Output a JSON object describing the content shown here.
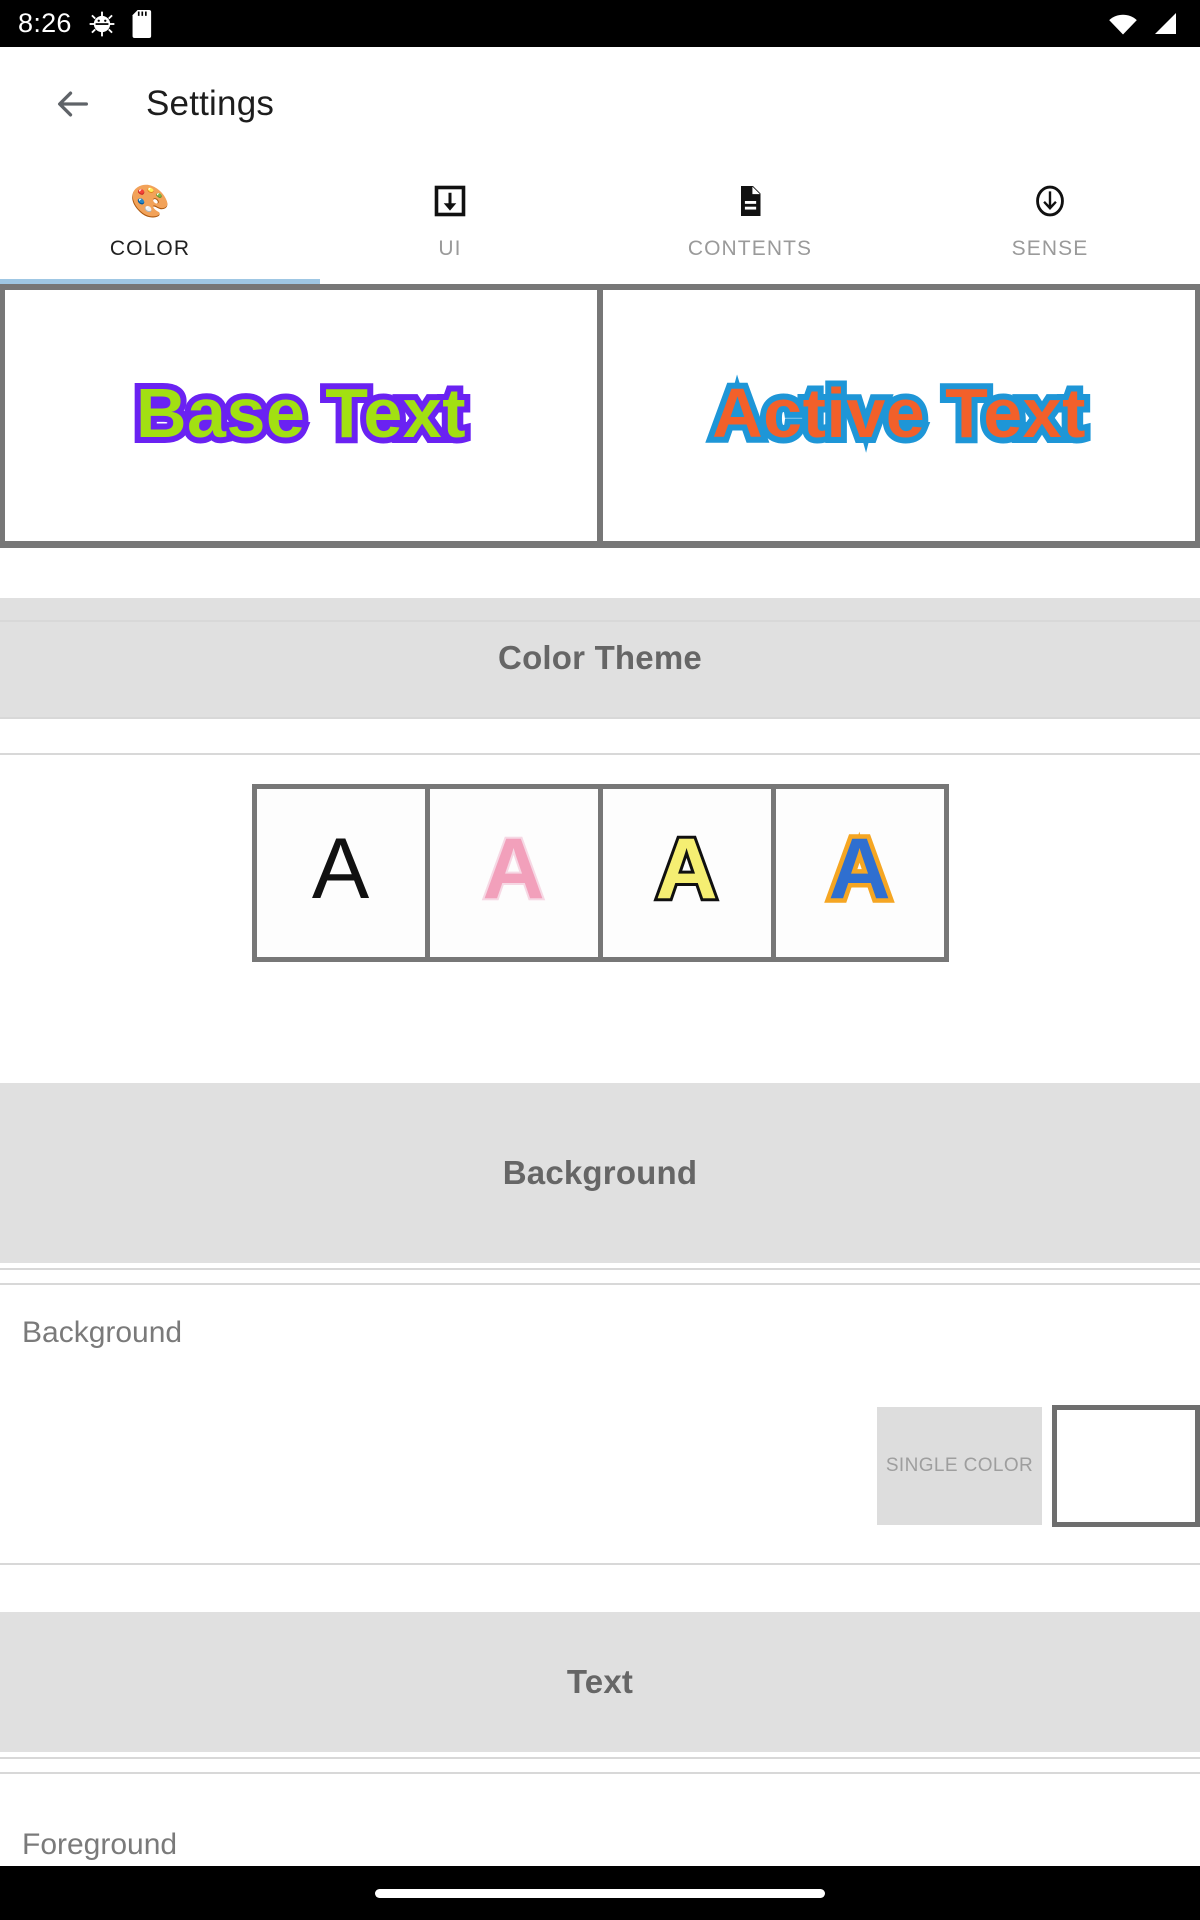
{
  "statusbar": {
    "time": "8:26",
    "icons": [
      "android-gear-icon",
      "sd-card-icon"
    ],
    "right_icons": [
      "wifi-icon",
      "cellular-signal-icon"
    ]
  },
  "appbar": {
    "back_icon": "arrow-left-icon",
    "title": "Settings"
  },
  "tabs": [
    {
      "label": "COLOR",
      "icon": "palette-icon",
      "glyph": "🎨",
      "selected": true
    },
    {
      "label": "UI",
      "icon": "download-box-icon",
      "selected": false
    },
    {
      "label": "CONTENTS",
      "icon": "document-icon",
      "selected": false
    },
    {
      "label": "SENSE",
      "icon": "circle-down-arrow-icon",
      "selected": false
    }
  ],
  "preview": {
    "base": {
      "text": "Base Text",
      "fill": "#a2e012",
      "outline": "#6a22f2"
    },
    "active": {
      "text": "Active Text",
      "fill": "#f2602a",
      "outline": "#1e96d7"
    }
  },
  "sections": [
    {
      "title": "Color Theme"
    },
    {
      "title": "Background"
    },
    {
      "title": "Text"
    }
  ],
  "color_theme": {
    "header": "Color Theme",
    "swatches": [
      {
        "glyph": "A",
        "fill": "#111111",
        "outline": "none"
      },
      {
        "glyph": "A",
        "fill": "#f2a0bb",
        "outline": "#f6d8e4"
      },
      {
        "glyph": "A",
        "fill": "#f5ee72",
        "outline": "#101010"
      },
      {
        "glyph": "A",
        "fill": "#2f6fd0",
        "outline": "#f5a623"
      }
    ]
  },
  "background_section": {
    "header": "Background",
    "row_label": "Background",
    "mode_chip": "SINGLE COLOR",
    "swatch_color": "#ffffff"
  },
  "text_section": {
    "header": "Text",
    "row_label": "Foreground"
  },
  "navbar": {
    "home_pill": "home-indicator"
  },
  "accents": {
    "tab_indicator": "#9fc7e4",
    "section_bg": "#e0e0e0",
    "frame_gray": "#777777"
  }
}
